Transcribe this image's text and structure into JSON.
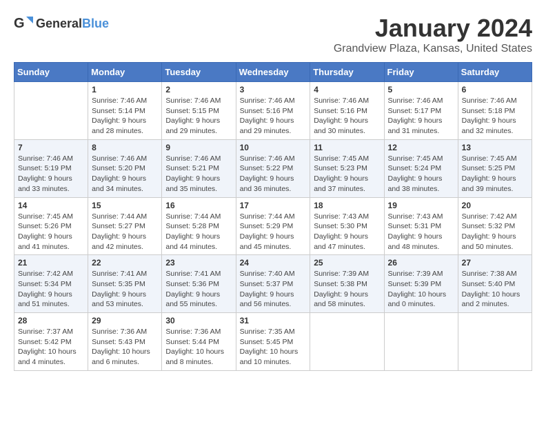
{
  "logo": {
    "text_general": "General",
    "text_blue": "Blue"
  },
  "title": "January 2024",
  "subtitle": "Grandview Plaza, Kansas, United States",
  "days_of_week": [
    "Sunday",
    "Monday",
    "Tuesday",
    "Wednesday",
    "Thursday",
    "Friday",
    "Saturday"
  ],
  "weeks": [
    [
      {
        "day": "",
        "sunrise": "",
        "sunset": "",
        "daylight": ""
      },
      {
        "day": "1",
        "sunrise": "Sunrise: 7:46 AM",
        "sunset": "Sunset: 5:14 PM",
        "daylight": "Daylight: 9 hours and 28 minutes."
      },
      {
        "day": "2",
        "sunrise": "Sunrise: 7:46 AM",
        "sunset": "Sunset: 5:15 PM",
        "daylight": "Daylight: 9 hours and 29 minutes."
      },
      {
        "day": "3",
        "sunrise": "Sunrise: 7:46 AM",
        "sunset": "Sunset: 5:16 PM",
        "daylight": "Daylight: 9 hours and 29 minutes."
      },
      {
        "day": "4",
        "sunrise": "Sunrise: 7:46 AM",
        "sunset": "Sunset: 5:16 PM",
        "daylight": "Daylight: 9 hours and 30 minutes."
      },
      {
        "day": "5",
        "sunrise": "Sunrise: 7:46 AM",
        "sunset": "Sunset: 5:17 PM",
        "daylight": "Daylight: 9 hours and 31 minutes."
      },
      {
        "day": "6",
        "sunrise": "Sunrise: 7:46 AM",
        "sunset": "Sunset: 5:18 PM",
        "daylight": "Daylight: 9 hours and 32 minutes."
      }
    ],
    [
      {
        "day": "7",
        "sunrise": "Sunrise: 7:46 AM",
        "sunset": "Sunset: 5:19 PM",
        "daylight": "Daylight: 9 hours and 33 minutes."
      },
      {
        "day": "8",
        "sunrise": "Sunrise: 7:46 AM",
        "sunset": "Sunset: 5:20 PM",
        "daylight": "Daylight: 9 hours and 34 minutes."
      },
      {
        "day": "9",
        "sunrise": "Sunrise: 7:46 AM",
        "sunset": "Sunset: 5:21 PM",
        "daylight": "Daylight: 9 hours and 35 minutes."
      },
      {
        "day": "10",
        "sunrise": "Sunrise: 7:46 AM",
        "sunset": "Sunset: 5:22 PM",
        "daylight": "Daylight: 9 hours and 36 minutes."
      },
      {
        "day": "11",
        "sunrise": "Sunrise: 7:45 AM",
        "sunset": "Sunset: 5:23 PM",
        "daylight": "Daylight: 9 hours and 37 minutes."
      },
      {
        "day": "12",
        "sunrise": "Sunrise: 7:45 AM",
        "sunset": "Sunset: 5:24 PM",
        "daylight": "Daylight: 9 hours and 38 minutes."
      },
      {
        "day": "13",
        "sunrise": "Sunrise: 7:45 AM",
        "sunset": "Sunset: 5:25 PM",
        "daylight": "Daylight: 9 hours and 39 minutes."
      }
    ],
    [
      {
        "day": "14",
        "sunrise": "Sunrise: 7:45 AM",
        "sunset": "Sunset: 5:26 PM",
        "daylight": "Daylight: 9 hours and 41 minutes."
      },
      {
        "day": "15",
        "sunrise": "Sunrise: 7:44 AM",
        "sunset": "Sunset: 5:27 PM",
        "daylight": "Daylight: 9 hours and 42 minutes."
      },
      {
        "day": "16",
        "sunrise": "Sunrise: 7:44 AM",
        "sunset": "Sunset: 5:28 PM",
        "daylight": "Daylight: 9 hours and 44 minutes."
      },
      {
        "day": "17",
        "sunrise": "Sunrise: 7:44 AM",
        "sunset": "Sunset: 5:29 PM",
        "daylight": "Daylight: 9 hours and 45 minutes."
      },
      {
        "day": "18",
        "sunrise": "Sunrise: 7:43 AM",
        "sunset": "Sunset: 5:30 PM",
        "daylight": "Daylight: 9 hours and 47 minutes."
      },
      {
        "day": "19",
        "sunrise": "Sunrise: 7:43 AM",
        "sunset": "Sunset: 5:31 PM",
        "daylight": "Daylight: 9 hours and 48 minutes."
      },
      {
        "day": "20",
        "sunrise": "Sunrise: 7:42 AM",
        "sunset": "Sunset: 5:32 PM",
        "daylight": "Daylight: 9 hours and 50 minutes."
      }
    ],
    [
      {
        "day": "21",
        "sunrise": "Sunrise: 7:42 AM",
        "sunset": "Sunset: 5:34 PM",
        "daylight": "Daylight: 9 hours and 51 minutes."
      },
      {
        "day": "22",
        "sunrise": "Sunrise: 7:41 AM",
        "sunset": "Sunset: 5:35 PM",
        "daylight": "Daylight: 9 hours and 53 minutes."
      },
      {
        "day": "23",
        "sunrise": "Sunrise: 7:41 AM",
        "sunset": "Sunset: 5:36 PM",
        "daylight": "Daylight: 9 hours and 55 minutes."
      },
      {
        "day": "24",
        "sunrise": "Sunrise: 7:40 AM",
        "sunset": "Sunset: 5:37 PM",
        "daylight": "Daylight: 9 hours and 56 minutes."
      },
      {
        "day": "25",
        "sunrise": "Sunrise: 7:39 AM",
        "sunset": "Sunset: 5:38 PM",
        "daylight": "Daylight: 9 hours and 58 minutes."
      },
      {
        "day": "26",
        "sunrise": "Sunrise: 7:39 AM",
        "sunset": "Sunset: 5:39 PM",
        "daylight": "Daylight: 10 hours and 0 minutes."
      },
      {
        "day": "27",
        "sunrise": "Sunrise: 7:38 AM",
        "sunset": "Sunset: 5:40 PM",
        "daylight": "Daylight: 10 hours and 2 minutes."
      }
    ],
    [
      {
        "day": "28",
        "sunrise": "Sunrise: 7:37 AM",
        "sunset": "Sunset: 5:42 PM",
        "daylight": "Daylight: 10 hours and 4 minutes."
      },
      {
        "day": "29",
        "sunrise": "Sunrise: 7:36 AM",
        "sunset": "Sunset: 5:43 PM",
        "daylight": "Daylight: 10 hours and 6 minutes."
      },
      {
        "day": "30",
        "sunrise": "Sunrise: 7:36 AM",
        "sunset": "Sunset: 5:44 PM",
        "daylight": "Daylight: 10 hours and 8 minutes."
      },
      {
        "day": "31",
        "sunrise": "Sunrise: 7:35 AM",
        "sunset": "Sunset: 5:45 PM",
        "daylight": "Daylight: 10 hours and 10 minutes."
      },
      {
        "day": "",
        "sunrise": "",
        "sunset": "",
        "daylight": ""
      },
      {
        "day": "",
        "sunrise": "",
        "sunset": "",
        "daylight": ""
      },
      {
        "day": "",
        "sunrise": "",
        "sunset": "",
        "daylight": ""
      }
    ]
  ]
}
